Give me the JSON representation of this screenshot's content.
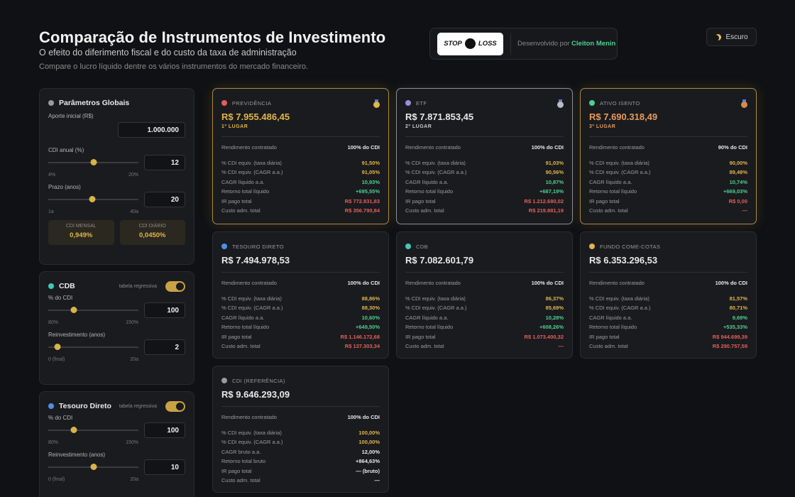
{
  "header": {
    "title": "Comparação de Instrumentos de Investimento",
    "subtitle": "O efeito do diferimento fiscal e do custo da taxa de administração",
    "description": "Compare o lucro líquido dentre os vários instrumentos do mercado financeiro."
  },
  "brand": {
    "logo_left": "STOP",
    "logo_right": "LOSS",
    "dev_prefix": "Desenvolvido por",
    "dev_name": "Cleiton Menin"
  },
  "theme_toggle": {
    "icon": "moon-icon",
    "label": "Escuro"
  },
  "global_params": {
    "title": "Parâmetros Globais",
    "dot_color": "#9a9a9a",
    "aporte_label": "Aporte inicial (R$)",
    "aporte_value": "1.000.000",
    "cdi_label": "CDI anual (%)",
    "cdi_value": "12",
    "cdi_min": "4%",
    "cdi_max": "20%",
    "cdi_fraction": 0.5,
    "prazo_label": "Prazo (anos)",
    "prazo_value": "20",
    "prazo_min": "1a",
    "prazo_max": "40a",
    "prazo_fraction": 0.487,
    "cdi_mensal_label": "CDI MENSAL",
    "cdi_mensal_value": "0,949%",
    "cdi_diario_label": "CDI DIÁRIO",
    "cdi_diario_value": "0,0450%"
  },
  "cdb_panel": {
    "title": "CDB",
    "dot_color": "#3ec9b9",
    "tag": "tabela regressiva",
    "pct_label": "% do CDI",
    "pct_value": "100",
    "pct_min": "80%",
    "pct_max": "150%",
    "pct_fraction": 0.286,
    "reinv_label": "Reinvestimento (anos)",
    "reinv_value": "2",
    "reinv_min": "0 (final)",
    "reinv_max": "20a",
    "reinv_fraction": 0.1
  },
  "tesouro_panel": {
    "title": "Tesouro Direto",
    "dot_color": "#4f8fe6",
    "tag": "tabela regressiva",
    "pct_label": "% do CDI",
    "pct_value": "100",
    "pct_min": "80%",
    "pct_max": "150%",
    "pct_fraction": 0.286,
    "reinv_label": "Reinvestimento (anos)",
    "reinv_value": "10",
    "reinv_min": "0 (final)",
    "reinv_max": "20a",
    "reinv_fraction": 0.5
  },
  "row_labels": {
    "rendimento": "Rendimento contratado",
    "taxa_diaria": "% CDI equiv. (taxa diária)",
    "cagr": "% CDI equiv. (CAGR a.a.)",
    "cagr_liquido": "CAGR líquido a.a.",
    "cagr_bruto": "CAGR bruto a.a.",
    "retorno_liquido": "Retorno total líquido",
    "retorno_bruto": "Retorno total bruto",
    "ir": "IR pago total",
    "custo": "Custo adm. total"
  },
  "cards": [
    {
      "name": "PREVIDÊNCIA",
      "dot_color": "#e0605a",
      "value": "R$ 7.955.486,45",
      "value_color": "#e0b44c",
      "place": "1º LUGAR",
      "place_color": "#e0b44c",
      "medal": "gold-medal-icon",
      "medal_color": "#e0b44c",
      "rendimento": "100% do CDI",
      "taxa_diaria": "91,50%",
      "cagr": "91,05%",
      "cagr_val": "10,93%",
      "retorno": "+695,55%",
      "ir": "R$ 772.831,83",
      "custo": "R$ 356.790,84"
    },
    {
      "name": "ETF",
      "dot_color": "#9b8ce6",
      "value": "R$ 7.871.853,45",
      "value_color": "#e8e8e8",
      "place": "2º LUGAR",
      "place_color": "#c9c9c9",
      "medal": "silver-medal-icon",
      "medal_color": "#b9bcc3",
      "rendimento": "100% do CDI",
      "taxa_diaria": "91,03%",
      "cagr": "90,56%",
      "cagr_val": "10,87%",
      "retorno": "+687,19%",
      "ir": "R$ 1.212.680,02",
      "custo": "R$ 219.881,19"
    },
    {
      "name": "ATIVO ISENTO",
      "dot_color": "#4cd08f",
      "value": "R$ 7.690.318,49",
      "value_color": "#e89a5c",
      "place": "3º LUGAR",
      "place_color": "#e89a5c",
      "medal": "bronze-medal-icon",
      "medal_color": "#d98a4a",
      "rendimento": "90% do CDI",
      "taxa_diaria": "90,00%",
      "cagr": "89,48%",
      "cagr_val": "10,74%",
      "retorno": "+669,03%",
      "ir": "R$ 0,00",
      "custo": "—"
    },
    {
      "name": "TESOURO DIRETO",
      "dot_color": "#4f8fe6",
      "value": "R$ 7.494.978,53",
      "value_color": "#e8e8e8",
      "rendimento": "100% do CDI",
      "taxa_diaria": "88,86%",
      "cagr": "88,30%",
      "cagr_val": "10,60%",
      "retorno": "+649,50%",
      "ir": "R$ 1.146.172,68",
      "custo": "R$ 137.303,34"
    },
    {
      "name": "CDB",
      "dot_color": "#3ec9b9",
      "value": "R$ 7.082.601,79",
      "value_color": "#e8e8e8",
      "rendimento": "100% do CDI",
      "taxa_diaria": "86,37%",
      "cagr": "85,69%",
      "cagr_val": "10,28%",
      "retorno": "+608,26%",
      "ir": "R$ 1.073.400,32",
      "custo": "—"
    },
    {
      "name": "FUNDO COME-COTAS",
      "dot_color": "#e0b44c",
      "value": "R$ 6.353.296,53",
      "value_color": "#e8e8e8",
      "rendimento": "100% do CDI",
      "taxa_diaria": "81,57%",
      "cagr": "80,71%",
      "cagr_val": "9,69%",
      "retorno": "+535,33%",
      "ir": "R$ 944.699,39",
      "custo": "R$ 290.757,59"
    },
    {
      "name": "CDI (REFERÊNCIA)",
      "dot_color": "#9a9a9a",
      "value": "R$ 9.646.293,09",
      "value_color": "#e8e8e8",
      "rendimento": "100% do CDI",
      "taxa_diaria": "100,00%",
      "cagr": "100,00%",
      "cagr_val": "12,00%",
      "retorno": "+864,63%",
      "ir": "— (bruto)",
      "custo": "—"
    }
  ]
}
